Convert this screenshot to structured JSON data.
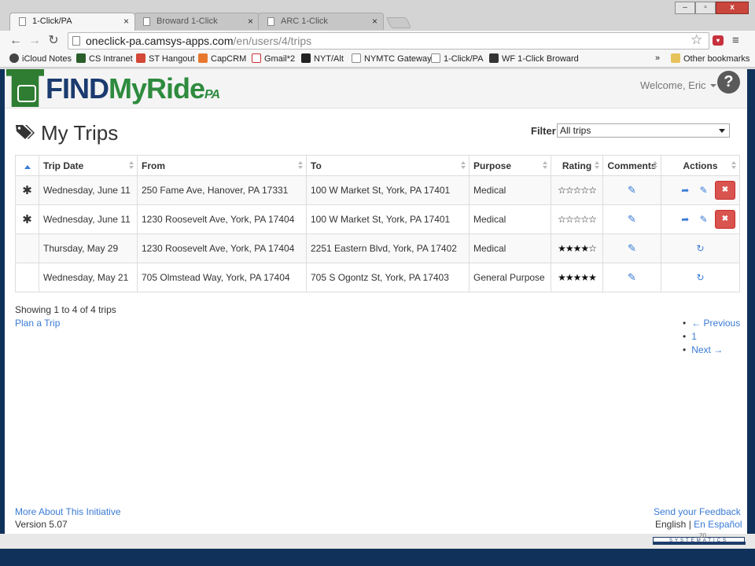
{
  "browser": {
    "tabs": [
      {
        "label": "1-Click/PA",
        "active": true
      },
      {
        "label": "Broward 1-Click",
        "active": false
      },
      {
        "label": "ARC 1-Click",
        "active": false
      }
    ],
    "url_host": "oneclick-pa.camsys-apps.com",
    "url_path": "/en/users/4/trips",
    "bookmarks": [
      "iCloud Notes",
      "CS Intranet",
      "ST Hangout",
      "CapCRM",
      "Gmail*2",
      "NYT/Alt",
      "NYMTC Gateway",
      "1-Click/PA",
      "WF 1-Click Broward"
    ],
    "bookmarks_overflow": "»",
    "other_bookmarks": "Other bookmarks",
    "window_buttons": {
      "minimize": "–",
      "maximize": "▫",
      "close": "x"
    }
  },
  "site": {
    "logo": {
      "find": "FIND",
      "myride": "MyRide",
      "pa": "PA"
    },
    "welcome": "Welcome, Eric",
    "help": "?"
  },
  "trips": {
    "title": "My Trips",
    "filter_label": "Filter",
    "filter_value": "All trips",
    "columns": [
      "Trip Date",
      "From",
      "To",
      "Purpose",
      "Rating",
      "Comments",
      "Actions"
    ],
    "rows": [
      {
        "mark": "✱",
        "date": "Wednesday, June 11",
        "from": "250 Fame Ave, Hanover, PA 17331",
        "to": "100 W Market St, York, PA 17401",
        "purpose": "Medical",
        "rating": 0,
        "upcoming": true
      },
      {
        "mark": "✱",
        "date": "Wednesday, June 11",
        "from": "1230 Roosevelt Ave, York, PA 17404",
        "to": "100 W Market St, York, PA 17401",
        "purpose": "Medical",
        "rating": 0,
        "upcoming": true
      },
      {
        "mark": "",
        "date": "Thursday, May 29",
        "from": "1230 Roosevelt Ave, York, PA 17404",
        "to": "2251 Eastern Blvd, York, PA 17402",
        "purpose": "Medical",
        "rating": 4,
        "upcoming": false
      },
      {
        "mark": "",
        "date": "Wednesday, May 21",
        "from": "705 Olmstead Way, York, PA 17404",
        "to": "705 S Ogontz St, York, PA 17403",
        "purpose": "General Purpose",
        "rating": 5,
        "upcoming": false
      }
    ],
    "showing": "Showing 1 to 4 of 4 trips",
    "plan_link": "Plan a Trip",
    "pager": {
      "previous": "← Previous",
      "page": "1",
      "next": "Next →"
    }
  },
  "footer": {
    "more": "More About This Initiative",
    "version": "Version 5.07",
    "feedback": "Send your Feedback",
    "lang_en": "English",
    "lang_sep": "|",
    "lang_es": "En Español"
  },
  "slide": {
    "badge": "SYSTEMATICS",
    "number": "20"
  },
  "colors": {
    "link": "#3a7bd5",
    "delete": "#d9534f",
    "logo_green": "#2e8b3e",
    "logo_blue": "#1b3b6f"
  }
}
